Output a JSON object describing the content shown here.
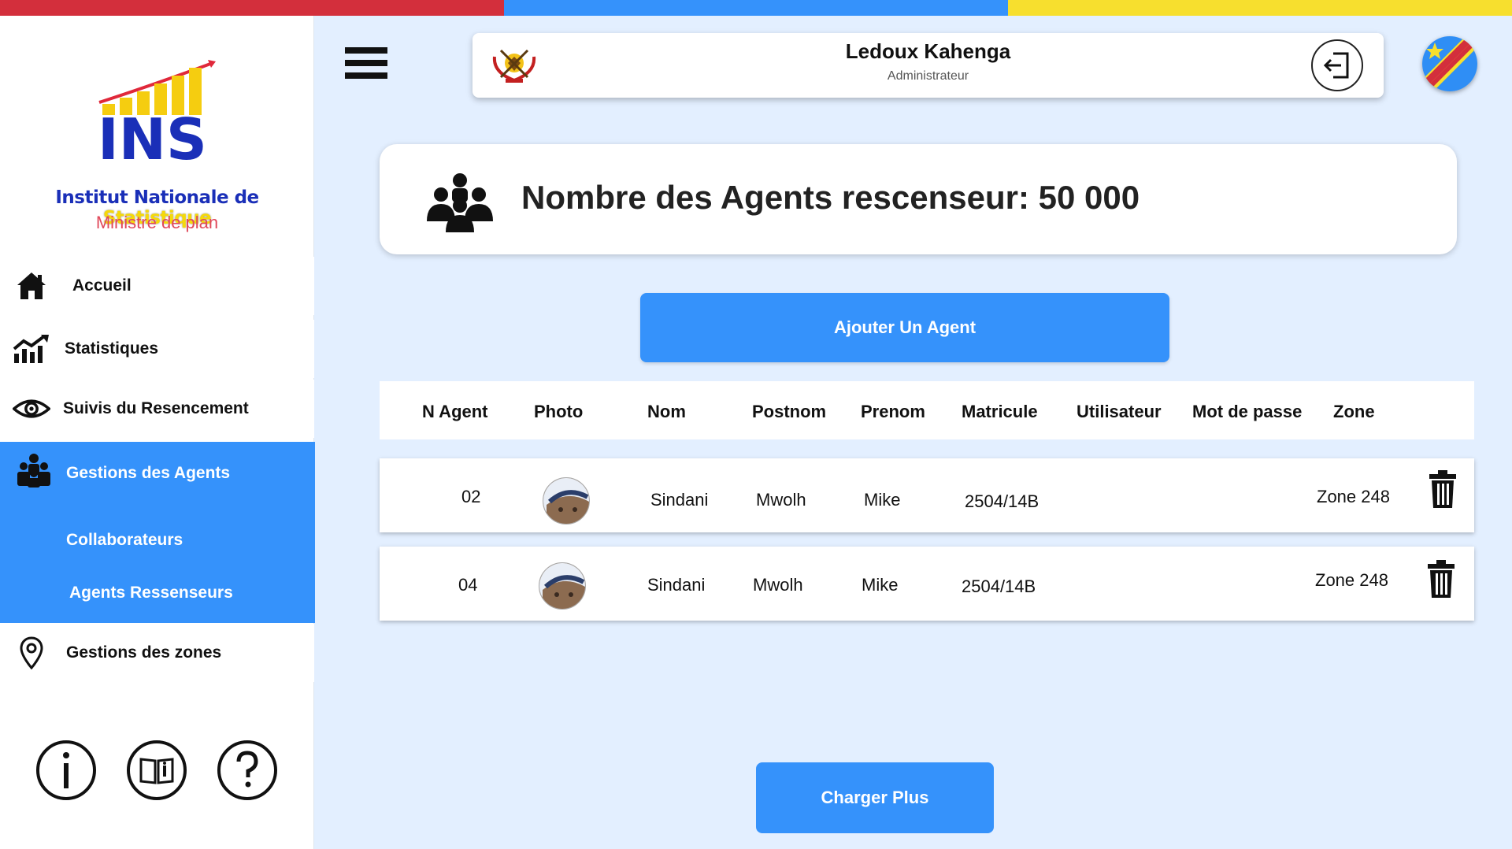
{
  "colors": {
    "stripe_red": "#d32f3c",
    "stripe_blue": "#3592fb",
    "stripe_yellow": "#f7df2e",
    "accent": "#3592fb"
  },
  "logo": {
    "text": "INS",
    "title_part1": "Institut Nationale de",
    "title_part2": "Statistique",
    "subtitle": "Ministre de plan"
  },
  "nav": {
    "home": "Accueil",
    "stats": "Statistiques",
    "census": "Suivis du Resencement",
    "agents": "Gestions des Agents",
    "collaborators": "Collaborateurs",
    "enumerators": "Agents Ressenseurs",
    "zones": "Gestions des zones"
  },
  "footer_icons": [
    "info-icon",
    "book-info-icon",
    "help-icon"
  ],
  "user": {
    "name": "Ledoux Kahenga",
    "role": "Administrateur"
  },
  "counter": {
    "label": "Nombre des Agents rescenseur: 50 000"
  },
  "buttons": {
    "add": "Ajouter Un Agent",
    "load_more": "Charger Plus"
  },
  "table": {
    "headers": [
      "N Agent",
      "Photo",
      "Nom",
      "Postnom",
      "Prenom",
      "Matricule",
      "Utilisateur",
      "Mot de passe",
      "Zone"
    ],
    "rows": [
      {
        "n": "02",
        "nom": "Sindani",
        "postnom": "Mwolh",
        "prenom": "Mike",
        "matricule": "2504/14B",
        "utilisateur": "",
        "mot_de_passe": "",
        "zone": "Zone 248"
      },
      {
        "n": "04",
        "nom": "Sindani",
        "postnom": "Mwolh",
        "prenom": "Mike",
        "matricule": "2504/14B",
        "utilisateur": "",
        "mot_de_passe": "",
        "zone": "Zone 248"
      }
    ]
  }
}
